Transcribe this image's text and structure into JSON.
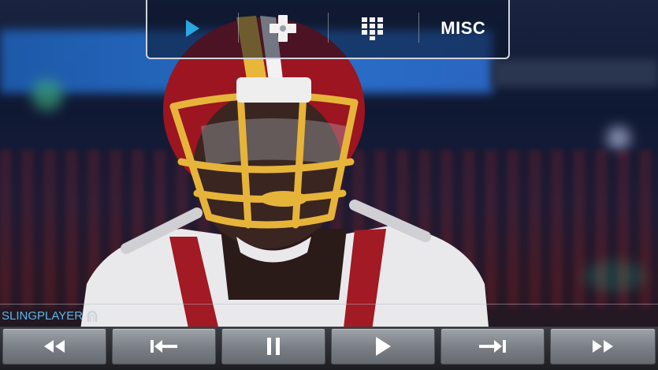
{
  "top_menu": {
    "items": [
      {
        "name": "play-mode-tab",
        "icon": "play-icon"
      },
      {
        "name": "dpad-tab",
        "icon": "dpad-icon"
      },
      {
        "name": "keypad-tab",
        "icon": "keypad-grid-icon"
      },
      {
        "name": "misc-tab",
        "label": "MISC"
      }
    ],
    "accent": "#29a8e0"
  },
  "brand": {
    "label": "SLINGPLAYER",
    "icon": "slingbox-logo-icon",
    "color": "#59b8e6"
  },
  "controls": [
    {
      "name": "rewind-button",
      "icon": "rewind-icon"
    },
    {
      "name": "skip-back-button",
      "icon": "skip-back-icon"
    },
    {
      "name": "pause-button",
      "icon": "pause-icon"
    },
    {
      "name": "play-button",
      "icon": "play-icon"
    },
    {
      "name": "skip-forward-button",
      "icon": "skip-forward-icon"
    },
    {
      "name": "fast-forward-button",
      "icon": "fast-forward-icon"
    }
  ]
}
